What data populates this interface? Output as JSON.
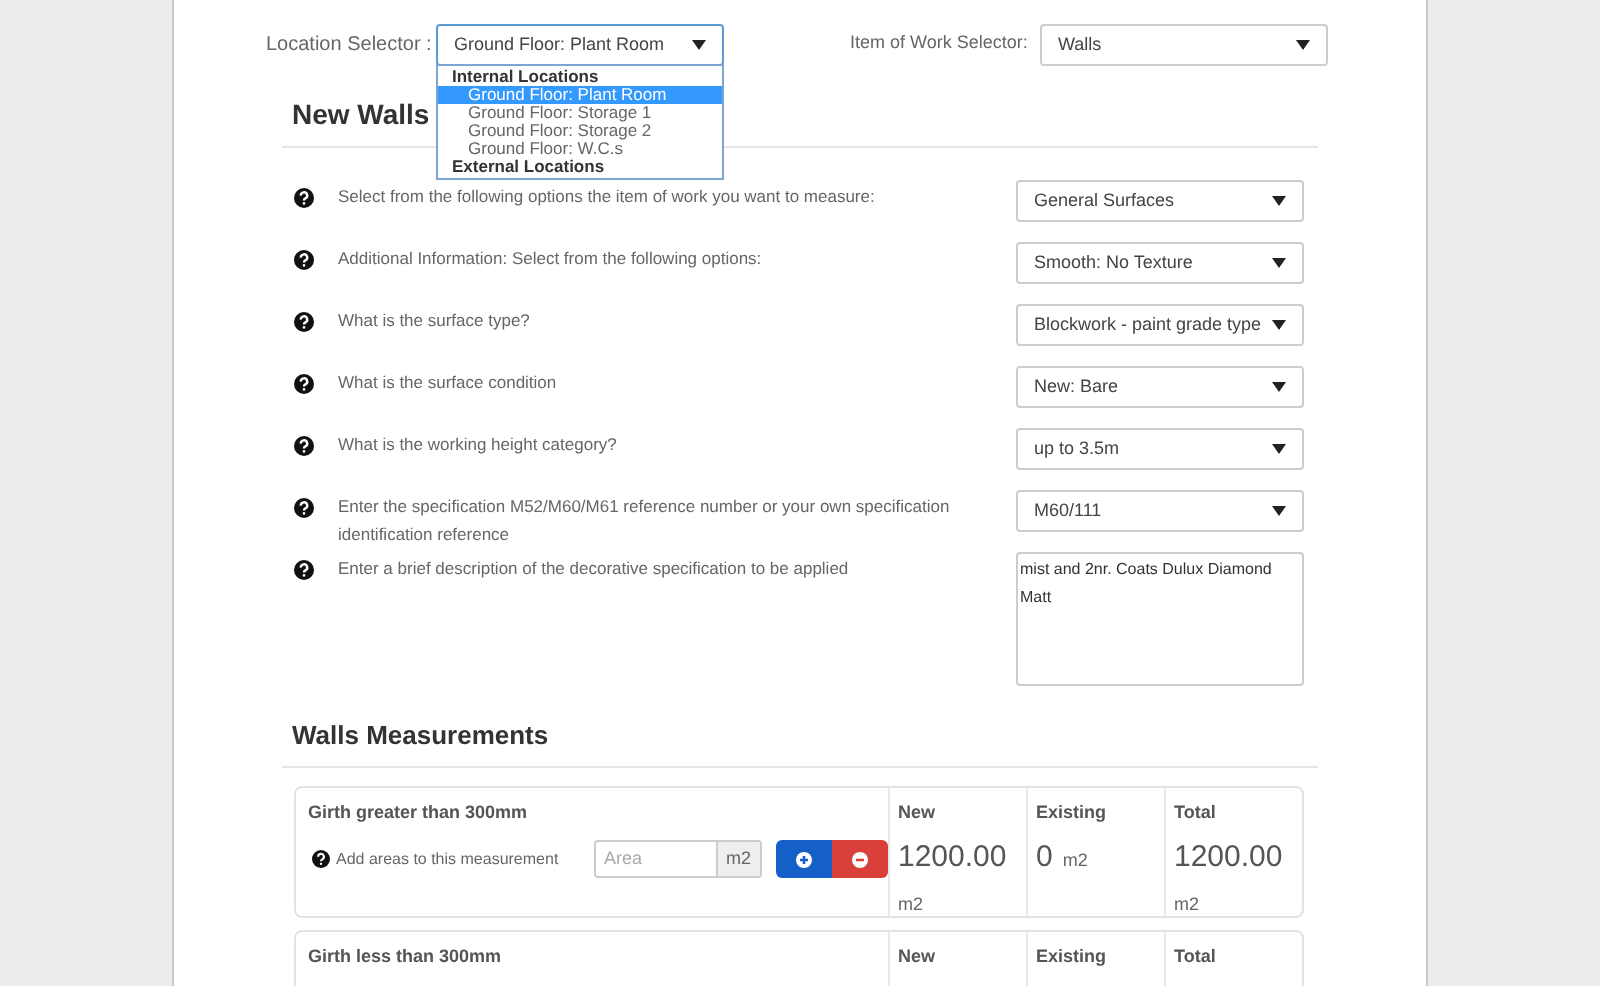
{
  "location_selector": {
    "label": "Location Selector :",
    "value": "Ground Floor: Plant Room",
    "expanded": true,
    "groups": [
      {
        "label": "Internal Locations",
        "options": [
          {
            "label": "Ground Floor: Plant Room",
            "selected": true
          },
          {
            "label": "Ground Floor: Storage 1",
            "selected": false
          },
          {
            "label": "Ground Floor: Storage 2",
            "selected": false
          },
          {
            "label": "Ground Floor: W.C.s",
            "selected": false
          }
        ]
      },
      {
        "label": "External Locations"
      }
    ]
  },
  "work_selector": {
    "label": "Item of Work Selector:",
    "value": "Walls"
  },
  "section_title": "New Walls",
  "questions": [
    {
      "kind": "select",
      "text": "Select from the following options the item of work you want to measure:",
      "value": "General Surfaces"
    },
    {
      "kind": "select",
      "text": "Additional Information: Select from the following options:",
      "value": "Smooth: No Texture"
    },
    {
      "kind": "select",
      "text": "What is the surface type?",
      "value": "Blockwork - paint grade type"
    },
    {
      "kind": "select",
      "text": "What is the surface condition",
      "value": "New: Bare"
    },
    {
      "kind": "select",
      "text": "What is the working height category?",
      "value": "up to 3.5m"
    },
    {
      "kind": "select",
      "text": "Enter the specification M52/M60/M61 reference number or your own specification identification reference",
      "value": "M60/111"
    },
    {
      "kind": "textarea",
      "text": "Enter a brief description of the decorative specification to be applied",
      "value": "mist and 2nr. Coats Dulux Diamond Matt"
    }
  ],
  "measurements_title": "Walls Measurements",
  "measurements": [
    {
      "title": "Girth greater than 300mm",
      "hint": "Add areas to this measurement",
      "placeholder": "Area",
      "unit": "m2",
      "new_label": "New",
      "new_value": "1200.00",
      "new_unit": "m2",
      "existing_label": "Existing",
      "existing_value": "0",
      "existing_unit": "m2",
      "total_label": "Total",
      "total_value": "1200.00",
      "total_unit": "m2"
    },
    {
      "title": "Girth less than 300mm",
      "new_label": "New",
      "existing_label": "Existing",
      "total_label": "Total"
    }
  ]
}
